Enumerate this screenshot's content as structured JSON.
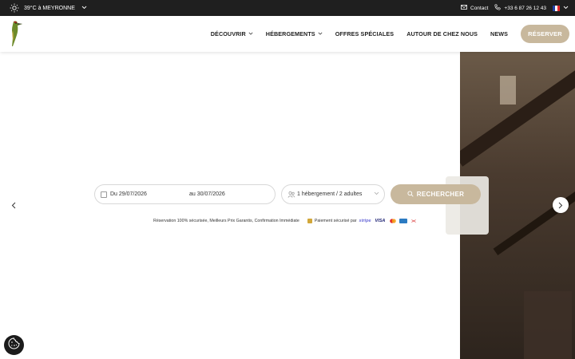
{
  "topbar": {
    "weather_text": "39°C à MEYRONNE",
    "contact_label": "Contact",
    "phone": "+33 6 87 26 12 43",
    "language_flag": "fr-flag-icon"
  },
  "nav": {
    "items": [
      {
        "label": "DÉCOUVRIR",
        "has_dropdown": true
      },
      {
        "label": "HÉBERGEMENTS",
        "has_dropdown": true
      },
      {
        "label": "OFFRES SPÉCIALES",
        "has_dropdown": false
      },
      {
        "label": "AUTOUR DE CHEZ NOUS",
        "has_dropdown": false
      },
      {
        "label": "NEWS",
        "has_dropdown": false
      }
    ],
    "book_label": "RÉSERVER"
  },
  "search": {
    "from_label": "Du",
    "from_date": "29/07/2026",
    "to_label": "au",
    "to_date": "30/07/2026",
    "guests": "1 hébergement / 2 adultes",
    "button_label": "RECHERCHER"
  },
  "trust": {
    "text": "Réservation 100% sécurisée, Meilleurs Prix Garantis, Confirmation Immédiate",
    "payment_text": "Paiement sécurisé par",
    "stripe_label": "stripe",
    "visa_label": "VISA"
  },
  "colors": {
    "accent": "#c8b89d",
    "topbar_bg": "#1f1f1f"
  }
}
